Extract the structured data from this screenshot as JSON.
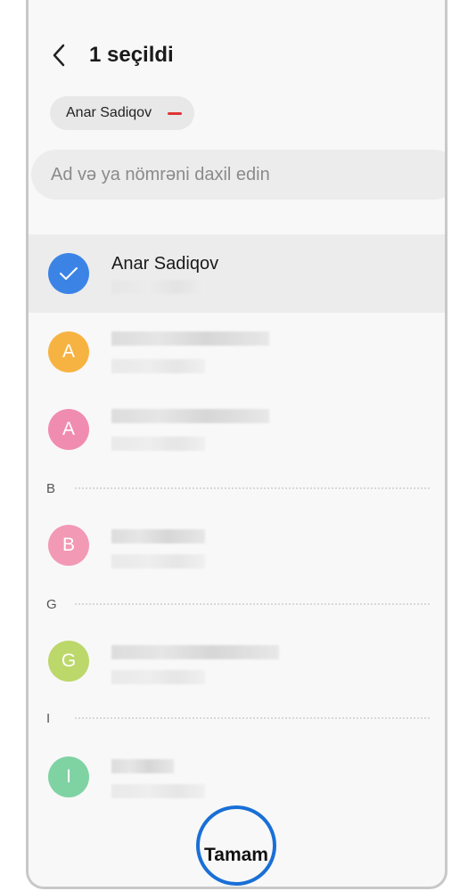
{
  "header": {
    "title": "1 seçildi",
    "back_icon": "chevron-left-icon"
  },
  "selected_chips": [
    {
      "label": "Anar Sadiqov",
      "remove_icon": "minus-icon",
      "remove_color": "#e03535"
    }
  ],
  "search": {
    "placeholder": "Ad və ya nömrəni daxil edin"
  },
  "contacts": [
    {
      "initial": "",
      "name": "Anar Sadiqov",
      "selected": true,
      "avatar_color": "#3b84e6",
      "avatar_icon": "checkmark-icon"
    },
    {
      "initial": "A",
      "name": "",
      "selected": false,
      "avatar_color": "#f7b342"
    },
    {
      "initial": "A",
      "name": "",
      "selected": false,
      "avatar_color": "#f08cb0"
    },
    {
      "section": "B"
    },
    {
      "initial": "B",
      "name": "",
      "selected": false,
      "avatar_color": "#f299b5"
    },
    {
      "section": "G"
    },
    {
      "initial": "G",
      "name": "",
      "selected": false,
      "avatar_color": "#bcd76a"
    },
    {
      "section": "I"
    },
    {
      "initial": "I",
      "name": "",
      "selected": false,
      "avatar_color": "#7fd3a3"
    }
  ],
  "footer": {
    "done_label": "Tamam",
    "accent": "#1a6fd6"
  }
}
